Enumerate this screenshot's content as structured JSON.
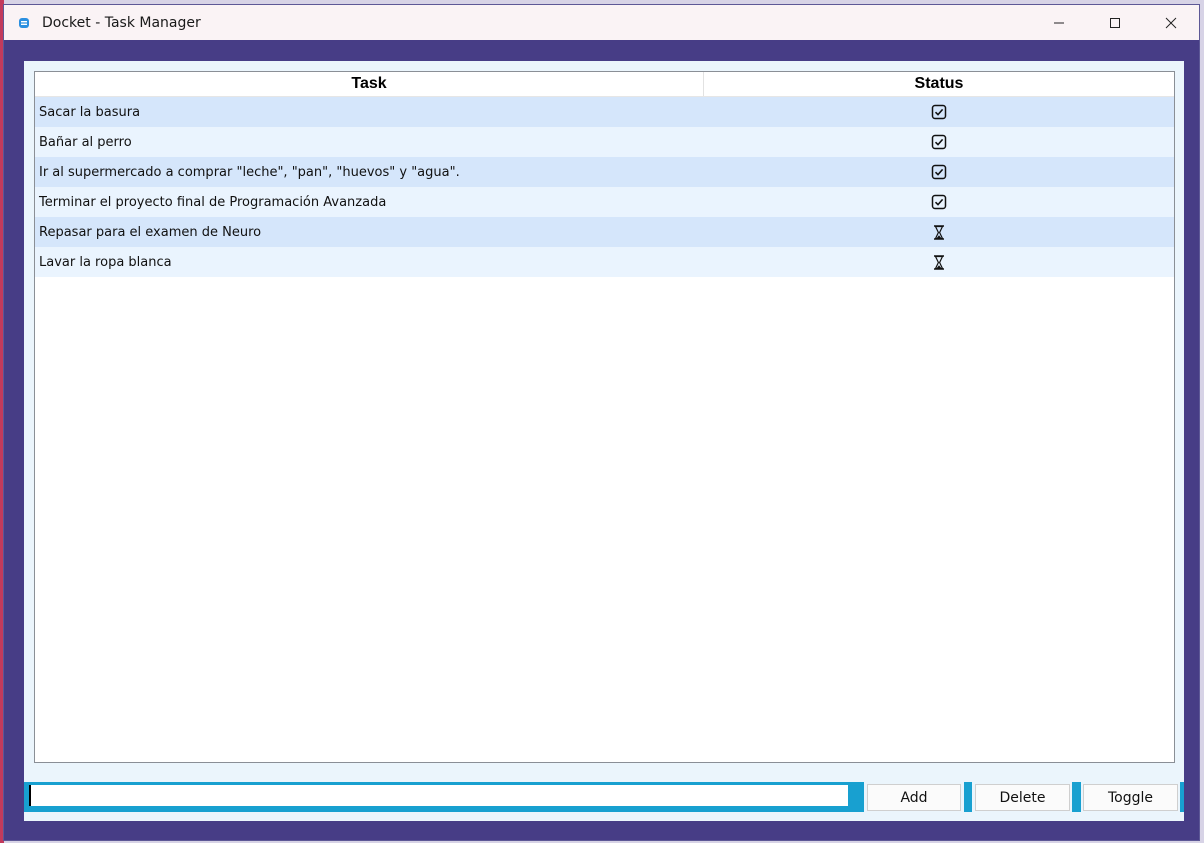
{
  "window": {
    "title": "Docket - Task Manager",
    "controls": {
      "minimize_icon": "minimize-icon",
      "maximize_icon": "maximize-icon",
      "close_icon": "close-icon"
    }
  },
  "table": {
    "columns": [
      "Task",
      "Status"
    ],
    "rows": [
      {
        "task": "Sacar la basura",
        "status": "done"
      },
      {
        "task": "Bañar al perro",
        "status": "done"
      },
      {
        "task": "Ir al supermercado a comprar \"leche\", \"pan\", \"huevos\" y \"agua\".",
        "status": "done"
      },
      {
        "task": "Terminar el proyecto final de Programación Avanzada",
        "status": "done"
      },
      {
        "task": "Repasar para el examen de Neuro",
        "status": "pending"
      },
      {
        "task": "Lavar la ropa blanca",
        "status": "pending"
      }
    ]
  },
  "input": {
    "value": "",
    "placeholder": ""
  },
  "buttons": {
    "add": "Add",
    "delete": "Delete",
    "toggle": "Toggle"
  },
  "colors": {
    "window_frame": "#473d86",
    "content_bg": "#ebf5fc",
    "row_odd": "#d5e6fb",
    "row_even": "#eaf4fe",
    "accent": "#18a0d0"
  },
  "icons": {
    "done": "checkbox-checked-icon",
    "pending": "hourglass-icon"
  }
}
